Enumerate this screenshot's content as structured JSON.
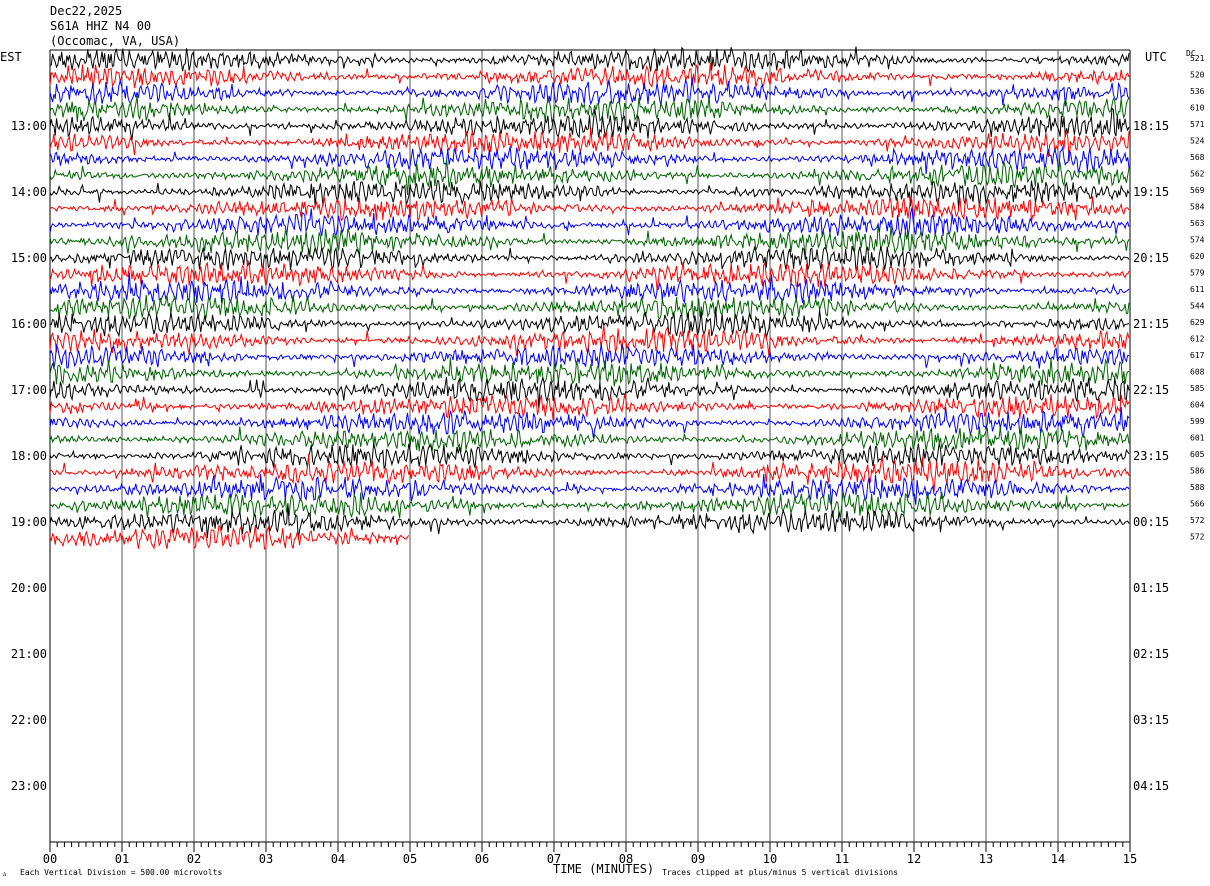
{
  "header": {
    "date": "Dec22,2025",
    "station": "S61A HHZ N4 00",
    "location": "(Occomac, VA, USA)"
  },
  "axes": {
    "left_zone_label": "EST",
    "right_zone_label": "UTC",
    "dc_label": "DC",
    "xlabel": "TIME (MINUTES)",
    "scale_note": "Each Vertical Division =  500.00 microvolts",
    "clip_note": "Traces clipped at plus/minus 5 vertical divisions"
  },
  "chart_data": {
    "type": "line",
    "description_kind": "helicorder",
    "x_ticks": [
      "00",
      "01",
      "02",
      "03",
      "04",
      "05",
      "06",
      "07",
      "08",
      "09",
      "10",
      "11",
      "12",
      "13",
      "14",
      "15"
    ],
    "xlim": [
      0,
      15
    ],
    "left_hour_labels": [
      "13:00",
      "14:00",
      "15:00",
      "16:00",
      "17:00",
      "18:00",
      "19:00",
      "20:00",
      "21:00",
      "22:00",
      "23:00"
    ],
    "right_hour_labels": [
      "18:15",
      "19:15",
      "20:15",
      "21:15",
      "22:15",
      "23:15",
      "00:15",
      "01:15",
      "02:15",
      "03:15",
      "04:15"
    ],
    "dc_offsets": [
      "521",
      "520",
      "536",
      "610",
      "571",
      "524",
      "568",
      "562",
      "569",
      "584",
      "563",
      "574",
      "620",
      "579",
      "611",
      "544",
      "629",
      "612",
      "617",
      "608",
      "585",
      "604",
      "599",
      "601",
      "605",
      "586",
      "588",
      "566",
      "572",
      "572"
    ],
    "trace_colors": [
      "#000000",
      "#ff0000",
      "#0000ff",
      "#006400"
    ],
    "rows_per_hour": 4,
    "minutes_per_row": 15,
    "first_row_hour_offset": -0.75,
    "total_traces": 30,
    "last_trace_end_minute": 5.0,
    "grid": true
  }
}
